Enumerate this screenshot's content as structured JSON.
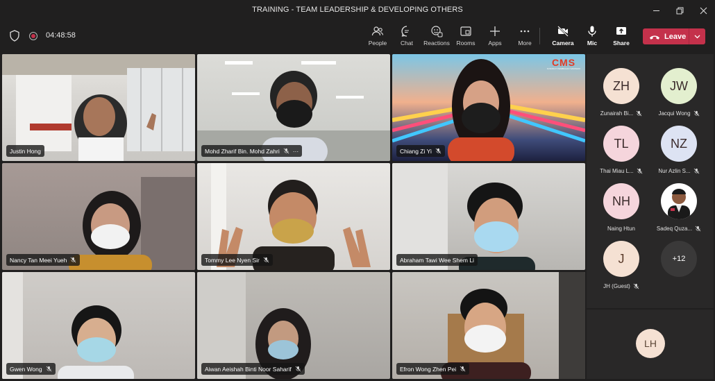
{
  "window": {
    "title": "TRAINING - TEAM LEADERSHIP & DEVELOPING OTHERS"
  },
  "meeting": {
    "timer": "04:48:58"
  },
  "toolbar": {
    "people": "People",
    "chat": "Chat",
    "reactions": "Reactions",
    "rooms": "Rooms",
    "apps": "Apps",
    "more": "More",
    "camera": "Camera",
    "mic": "Mic",
    "share": "Share",
    "leave": "Leave"
  },
  "colors": {
    "leave": "#c4314b",
    "avatar_bg": "#f5e1d3",
    "bg": "#201f1f"
  },
  "tiles": [
    {
      "name": "Justin Hong"
    },
    {
      "name": "Mohd Zharif Bin. Mohd Zahri",
      "extra": "···"
    },
    {
      "name": "Chiang Zi Yi"
    },
    {
      "name": "Nancy Tan Meei Yueh"
    },
    {
      "name": "Tommy Lee Nyen Sir"
    },
    {
      "name": "Abraham Tawi Wee Shem Li"
    },
    {
      "name": "Gwen Wong"
    },
    {
      "name": "Aiwan Aeishah Binti Noor Saharif"
    },
    {
      "name": "Efron Wong Zhen Pei"
    }
  ],
  "tile3_logo": {
    "brand": "CMS",
    "tagline": "SYARIKAT PEMBINAAN SARAWAK"
  },
  "roster": [
    {
      "initials": "ZH",
      "name": "Zunairah Bi..."
    },
    {
      "initials": "JW",
      "name": "Jacqui Wong"
    },
    {
      "initials": "TL",
      "name": "Thai Miau L..."
    },
    {
      "initials": "NZ",
      "name": "Nur Azlin S..."
    },
    {
      "initials": "NH",
      "name": "Naing Htun"
    },
    {
      "initials": "",
      "name": "Sadeq Quza..."
    },
    {
      "initials": "J",
      "name": "JH (Guest)"
    },
    {
      "initials": "+12",
      "name": ""
    }
  ],
  "self": {
    "initials": "LH"
  }
}
